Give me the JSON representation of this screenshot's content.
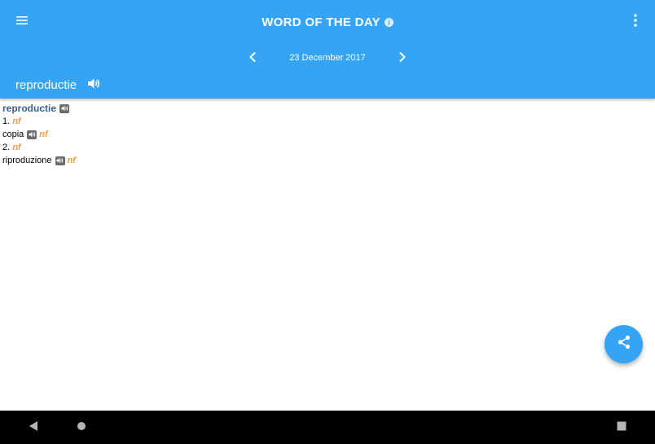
{
  "app_bar": {
    "title": "WORD OF THE DAY",
    "date": "23 December 2017",
    "word": "reproductie",
    "icons": {
      "menu": "hamburger-menu-icon",
      "info": "info-icon",
      "more": "more-vertical-icon",
      "prev": "chevron-left-icon",
      "next": "chevron-right-icon",
      "speaker": "speaker-icon"
    },
    "color": "#35a4f4"
  },
  "entry": {
    "headword": "reproductie",
    "senses": [
      {
        "number": "1.",
        "pos": "nf",
        "translation": "copia",
        "translation_pos": "nf"
      },
      {
        "number": "2.",
        "pos": "nf",
        "translation": "riproduzione",
        "translation_pos": "nf"
      }
    ],
    "colors": {
      "headword": "#3a5f8f",
      "pos": "#f39a3c"
    }
  },
  "fab": {
    "icon": "share-icon"
  },
  "system_nav": {
    "back": "back-triangle-icon",
    "home": "home-circle-icon",
    "recents": "recents-square-icon"
  }
}
